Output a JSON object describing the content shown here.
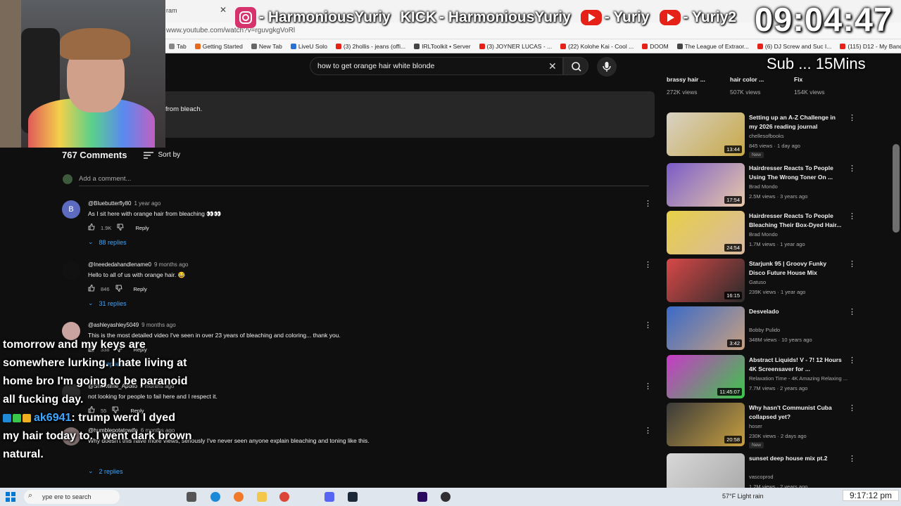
{
  "browser": {
    "tab_title": "ram",
    "url": "www.youtube.com/watch?v=rguvgkgVoRl",
    "bookmarks": [
      {
        "label": "Tab",
        "color": "#888888"
      },
      {
        "label": "Getting Started",
        "color": "#e66a1f"
      },
      {
        "label": "New Tab",
        "color": "#666666"
      },
      {
        "label": "LiveU Solo",
        "color": "#2a6fd6"
      },
      {
        "label": "(3) 2hollis - jeans (offi...",
        "color": "#e62117"
      },
      {
        "label": "IRLToolkit • Server",
        "color": "#444444"
      },
      {
        "label": "(3) JOYNER LUCAS - ...",
        "color": "#e62117"
      },
      {
        "label": "(22) Kolohe Kai - Cool ...",
        "color": "#e62117"
      },
      {
        "label": "DOOM",
        "color": "#e62117"
      },
      {
        "label": "The League of Extraor...",
        "color": "#444444"
      },
      {
        "label": "(6) DJ Screw and Suc I...",
        "color": "#e62117"
      },
      {
        "label": "(115) D12 - My Band...",
        "color": "#e62117"
      }
    ]
  },
  "youtube": {
    "search_query": "how to get orange hair white blonde",
    "description_snippet": "from bleach.",
    "comment_count": "767 Comments",
    "sort_label": "Sort by",
    "add_comment_placeholder": "Add a comment...",
    "comments": [
      {
        "initial": "B",
        "avatar_color": "#5c6bc0",
        "author": "@Bluebutterfly80",
        "time": "1 year ago",
        "text": "As I sit here with orange hair from bleaching 👀👀",
        "likes": "1.9K",
        "reply": "Reply",
        "replies": "88 replies"
      },
      {
        "initial": "",
        "avatar_color": "#111111",
        "author": "@Ineededahandlename0",
        "time": "9 months ago",
        "text": "Hello to all of us with orange hair. 😂",
        "likes": "846",
        "reply": "Reply",
        "replies": "31 replies"
      },
      {
        "initial": "",
        "avatar_color": "#c9a3a0",
        "author": "@ashleyashley5049",
        "time": "9 months ago",
        "text": "This is the most detailed video I've seen in over 23 years of bleaching and coloring... thank you.",
        "likes": "338",
        "reply": "Reply",
        "replies": "2 replies"
      },
      {
        "initial": "",
        "avatar_color": "#2b2b2b",
        "author": "@Showtime_Apollo",
        "time": "2 months ago",
        "text": "not looking for people to fail here and I respect it.",
        "likes": "55",
        "reply": "Reply",
        "replies": ""
      },
      {
        "initial": "",
        "avatar_color": "#7a6a6a",
        "author": "@humblepotatowife",
        "time": "6 months ago",
        "text": "Why doesn't this have more views, seriously I've never seen anyone explain bleaching and toning like this.",
        "likes": "",
        "reply": "",
        "replies": "2 replies"
      }
    ],
    "top_recs": [
      {
        "title": "brassy hair ...",
        "views": "272K views"
      },
      {
        "title": "hair color ...",
        "views": "507K views"
      },
      {
        "title": "Fix",
        "views": "154K views"
      }
    ],
    "recommendations": [
      {
        "title": "Setting up an A-Z Challenge in my 2026 reading journal",
        "channel": "chellesofbooks",
        "meta": "845 views · 1 day ago",
        "badge": "New",
        "duration": "13:44",
        "thumb_a": "#d8d2c4",
        "thumb_b": "#c8a848"
      },
      {
        "title": "Hairdresser Reacts To People Using The Wrong Toner On ...",
        "channel": "Brad Mondo",
        "meta": "2.5M views · 3 years ago",
        "badge": "",
        "duration": "17:54",
        "thumb_a": "#7a5cc8",
        "thumb_b": "#e8c8a8"
      },
      {
        "title": "Hairdresser Reacts To People Bleaching Their Box-Dyed Hair...",
        "channel": "Brad Mondo",
        "meta": "1.7M views · 1 year ago",
        "badge": "",
        "duration": "24:54",
        "thumb_a": "#e8d048",
        "thumb_b": "#d8b8a0"
      },
      {
        "title": "Starjunk 95 | Groovy Funky Disco Future House Mix",
        "channel": "Gatuso",
        "meta": "239K views · 1 year ago",
        "badge": "",
        "duration": "16:15",
        "thumb_a": "#d84848",
        "thumb_b": "#2a2a2a"
      },
      {
        "title": "Desvelado",
        "channel": "Bobby Pulido",
        "meta": "348M views · 10 years ago",
        "badge": "",
        "duration": "3:42",
        "thumb_a": "#3a6ac8",
        "thumb_b": "#c8a080"
      },
      {
        "title": "Abstract Liquids! V - 7! 12 Hours 4K Screensaver for ...",
        "channel": "Relaxation Time - 4K Amazing Relaxing ...",
        "meta": "7.7M views · 2 years ago",
        "badge": "",
        "duration": "11:45:07",
        "thumb_a": "#c83ac8",
        "thumb_b": "#3ac848"
      },
      {
        "title": "Why hasn't Communist Cuba collapsed yet?",
        "channel": "hoser",
        "meta": "230K views · 2 days ago",
        "badge": "New",
        "duration": "20:58",
        "thumb_a": "#3a3a3a",
        "thumb_b": "#c8a040"
      },
      {
        "title": "sunset deep house mix pt.2",
        "channel": "vascoprod",
        "meta": "1.2M views · 2 years ago",
        "badge": "",
        "duration": "",
        "thumb_a": "#d8d8d8",
        "thumb_b": "#a8a8a8"
      }
    ]
  },
  "overlay": {
    "socials": [
      {
        "label": "- HarmoniousYuriy",
        "icon": "instagram-icon",
        "color": "#d6336c"
      },
      {
        "label": "- HarmoniousYuriy",
        "icon": "kick-icon",
        "color": "#53fc18"
      },
      {
        "label": "- Yuriy",
        "icon": "youtube-icon",
        "color": "#e62117"
      },
      {
        "label": "- Yuriy2",
        "icon": "youtube-icon",
        "color": "#e62117"
      }
    ],
    "kick_text": "KICK",
    "clock": "09:04:47",
    "sub_timer": "Sub ... 15Mins",
    "chat": [
      {
        "name": "",
        "text": "tomorrow and my keys are"
      },
      {
        "name": "",
        "text": "somewhere lurking. I hate living at"
      },
      {
        "name": "",
        "text": "home bro I'm going to be paranoid"
      },
      {
        "name": "",
        "text": "all fucking day."
      },
      {
        "name": "ak6941",
        "text": ": trump werd I dyed"
      },
      {
        "name": "",
        "text": "my hair today to. I went dark brown"
      },
      {
        "name": "",
        "text": "natural."
      }
    ]
  },
  "taskbar": {
    "search_placeholder": "ype  ere to search",
    "weather": "57°F  Light rain",
    "clock": "9:17:12 pm"
  }
}
